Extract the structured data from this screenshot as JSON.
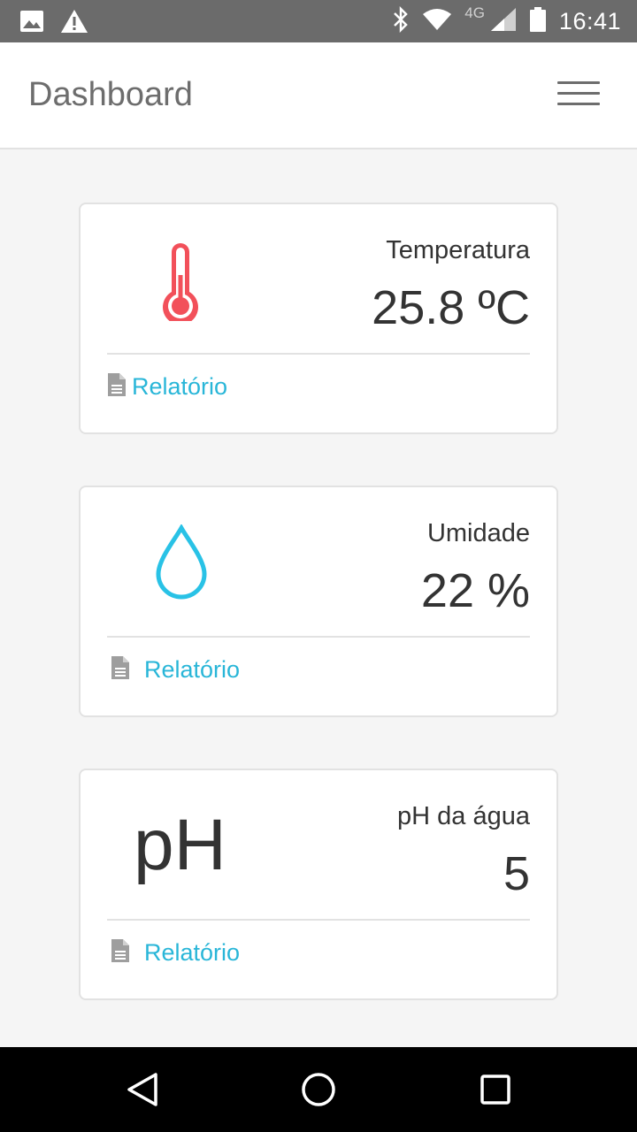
{
  "status_bar": {
    "time": "16:41",
    "network": "4G",
    "icons": [
      "image-icon",
      "warning-icon",
      "bluetooth-icon",
      "wifi-icon",
      "signal-icon",
      "battery-icon"
    ]
  },
  "app_bar": {
    "title": "Dashboard",
    "menu_icon": "hamburger-menu-icon"
  },
  "cards": [
    {
      "label": "Temperatura",
      "value": "25.8 ºC",
      "icon": "thermometer-icon",
      "icon_color": "#f2505a",
      "link": "Relatório"
    },
    {
      "label": "Umidade",
      "value": "22 %",
      "icon": "water-drop-icon",
      "icon_color": "#29c2e6",
      "link": "Relatório"
    },
    {
      "label": "pH da água",
      "value": "5",
      "icon_text": "pH",
      "link": "Relatório"
    }
  ],
  "colors": {
    "accent": "#29b6d8",
    "app_bar_bg": "#ffffff",
    "page_bg": "#f5f5f5",
    "status_bar_bg": "#6b6b6b"
  },
  "nav_bar": {
    "icons": [
      "back-icon",
      "home-icon",
      "recents-icon"
    ]
  }
}
